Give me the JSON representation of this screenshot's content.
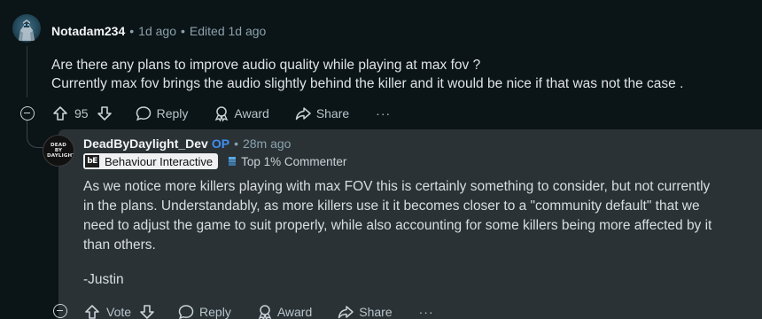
{
  "comment": {
    "username": "Notadam234",
    "time": "1d ago",
    "edited": "Edited 1d ago",
    "body_lines": [
      "Are there any plans to improve audio quality while playing at max fov ?",
      "Currently max fov brings the audio slightly behind the killer and it would be nice if that was not the case ."
    ],
    "actions": {
      "score": "95",
      "reply": "Reply",
      "award": "Award",
      "share": "Share",
      "more": "···"
    }
  },
  "reply": {
    "username": "DeadByDaylight_Dev",
    "op_label": "OP",
    "time": "28m ago",
    "avatar_text": "DEAD BY DAYLIGHT",
    "flair_logo": "bE",
    "flair": "Behaviour Interactive",
    "badge": "Top 1% Commenter",
    "body_lines": [
      "As we notice more killers playing with max FOV this is certainly something to consider, but not currently",
      "in the plans. Understandably, as more killers use it it becomes closer to a \"community default\" that we",
      "need to adjust the game to suit properly, while also accounting for some killers being more affected by it",
      "than others."
    ],
    "signature": "-Justin",
    "actions": {
      "vote": "Vote",
      "reply": "Reply",
      "award": "Award",
      "share": "Share",
      "more": "···"
    }
  },
  "colors": {
    "background": "#0b1416",
    "reply_background": "#2a3236",
    "op_blue": "#3f8ff0",
    "text": "#d7dadc"
  }
}
